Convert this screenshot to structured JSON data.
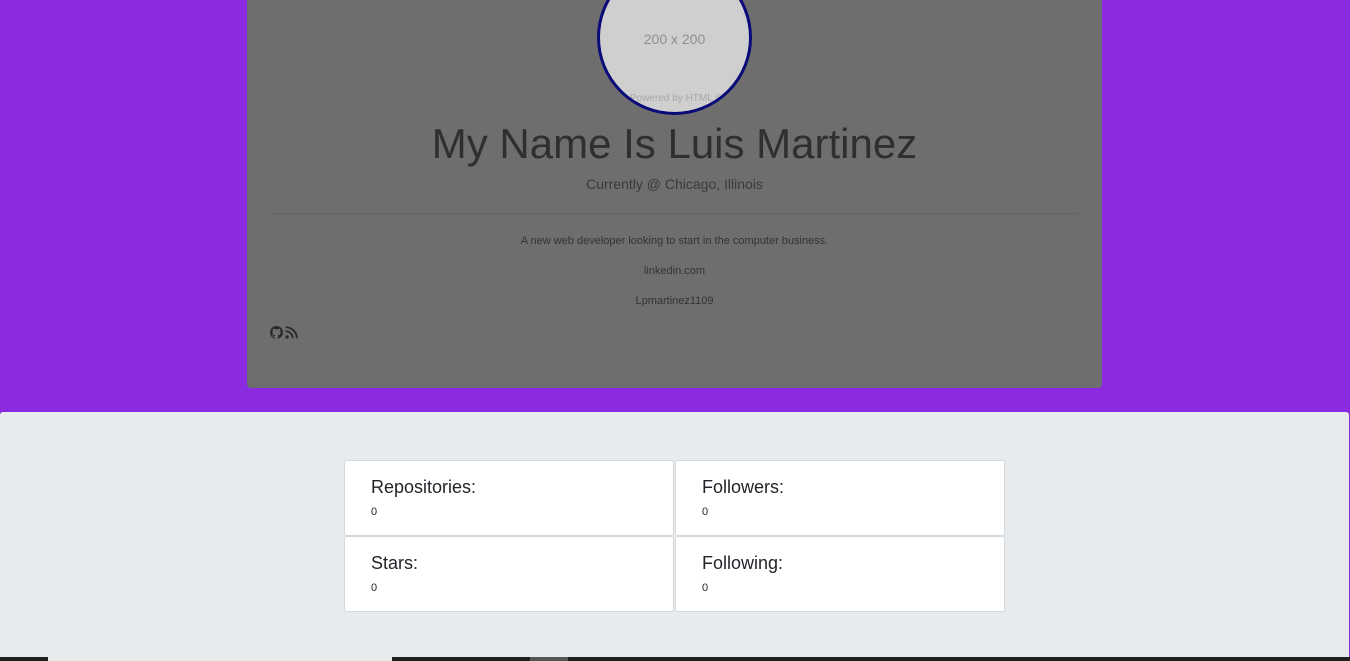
{
  "profile": {
    "avatar_placeholder": "200 x 200",
    "avatar_credit": "Powered by HTML.COM",
    "name": "My Name Is Luis Martinez",
    "location": "Currently @ Chicago, Illinois",
    "bio": "A new web developer looking to start in the computer business.",
    "linkedin": "linkedin.com",
    "username": "Lpmartinez1109",
    "social_icons": [
      "github-icon",
      "rss-icon"
    ]
  },
  "stats": {
    "repositories": {
      "label": "Repositories:",
      "value": "0"
    },
    "followers": {
      "label": "Followers:",
      "value": "0"
    },
    "stars": {
      "label": "Stars:",
      "value": "0"
    },
    "following": {
      "label": "Following:",
      "value": "0"
    }
  },
  "colors": {
    "page_background": "#8a2be2",
    "card_background": "#6e6e6e",
    "avatar_border": "#0a0a78",
    "stats_background": "#e8ebee"
  }
}
